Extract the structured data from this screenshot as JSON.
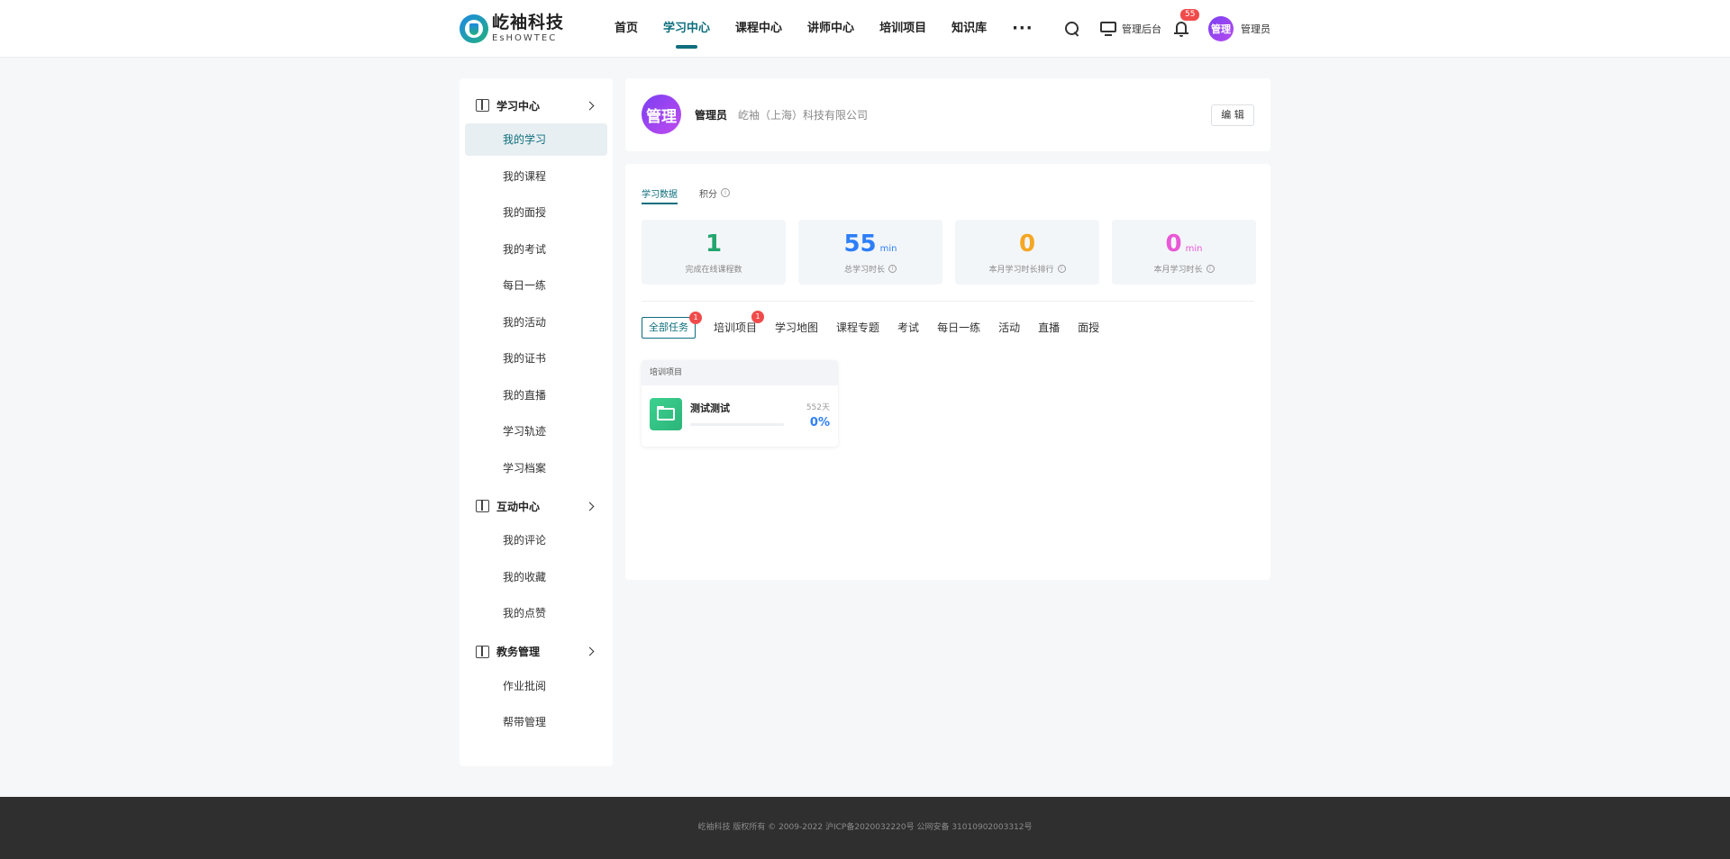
{
  "header": {
    "logo_cn": "屹袖科技",
    "logo_en": "EsHOWTEC",
    "nav": [
      {
        "label": "首页"
      },
      {
        "label": "学习中心",
        "active": true
      },
      {
        "label": "课程中心"
      },
      {
        "label": "讲师中心"
      },
      {
        "label": "培训项目"
      },
      {
        "label": "知识库"
      }
    ],
    "more_label": "···",
    "admin_label": "管理后台",
    "notification_count": "55",
    "avatar_text": "管理",
    "user_name": "管理员"
  },
  "sidebar": {
    "groups": [
      {
        "label": "学习中心",
        "icon": "book-icon",
        "items": [
          "我的学习",
          "我的课程",
          "我的面授",
          "我的考试",
          "每日一练",
          "我的活动",
          "我的证书",
          "我的直播",
          "学习轨迹",
          "学习档案"
        ],
        "active_index": 0
      },
      {
        "label": "互动中心",
        "icon": "chat-icon",
        "items": [
          "我的评论",
          "我的收藏",
          "我的点赞"
        ]
      },
      {
        "label": "教务管理",
        "icon": "org-chart-icon",
        "items": [
          "作业批阅",
          "帮带管理"
        ]
      }
    ]
  },
  "profile": {
    "avatar_text": "管理",
    "name": "管理员",
    "company": "屹袖（上海）科技有限公司",
    "edit_label": "编 辑"
  },
  "main": {
    "tabs": [
      {
        "label": "学习数据",
        "active": true
      },
      {
        "label": "积分",
        "info": true
      }
    ],
    "stats": [
      {
        "value": "1",
        "unit": "",
        "label": "完成在线课程数",
        "color": "#22a66e",
        "info": false
      },
      {
        "value": "55",
        "unit": "min",
        "label": "总学习时长",
        "color": "#2d7ff9",
        "info": true
      },
      {
        "value": "0",
        "unit": "",
        "label": "本月学习时长排行",
        "color": "#f5a623",
        "info": true
      },
      {
        "value": "0",
        "unit": "min",
        "label": "本月学习时长",
        "color": "#e958d6",
        "info": true
      }
    ],
    "subtabs": [
      {
        "label": "全部任务",
        "active": true,
        "badge": "1"
      },
      {
        "label": "培训项目",
        "badge": "1"
      },
      {
        "label": "学习地图"
      },
      {
        "label": "课程专题"
      },
      {
        "label": "考试"
      },
      {
        "label": "每日一练"
      },
      {
        "label": "活动"
      },
      {
        "label": "直播"
      },
      {
        "label": "面授"
      }
    ],
    "task": {
      "category": "培训项目",
      "title": "测试测试",
      "days": "552天",
      "percent": "0%",
      "progress": 0
    }
  },
  "footer": {
    "text": "屹袖科技 版权所有 © 2009-2022 沪ICP备2020032220号 公网安备 31010902003312号"
  }
}
